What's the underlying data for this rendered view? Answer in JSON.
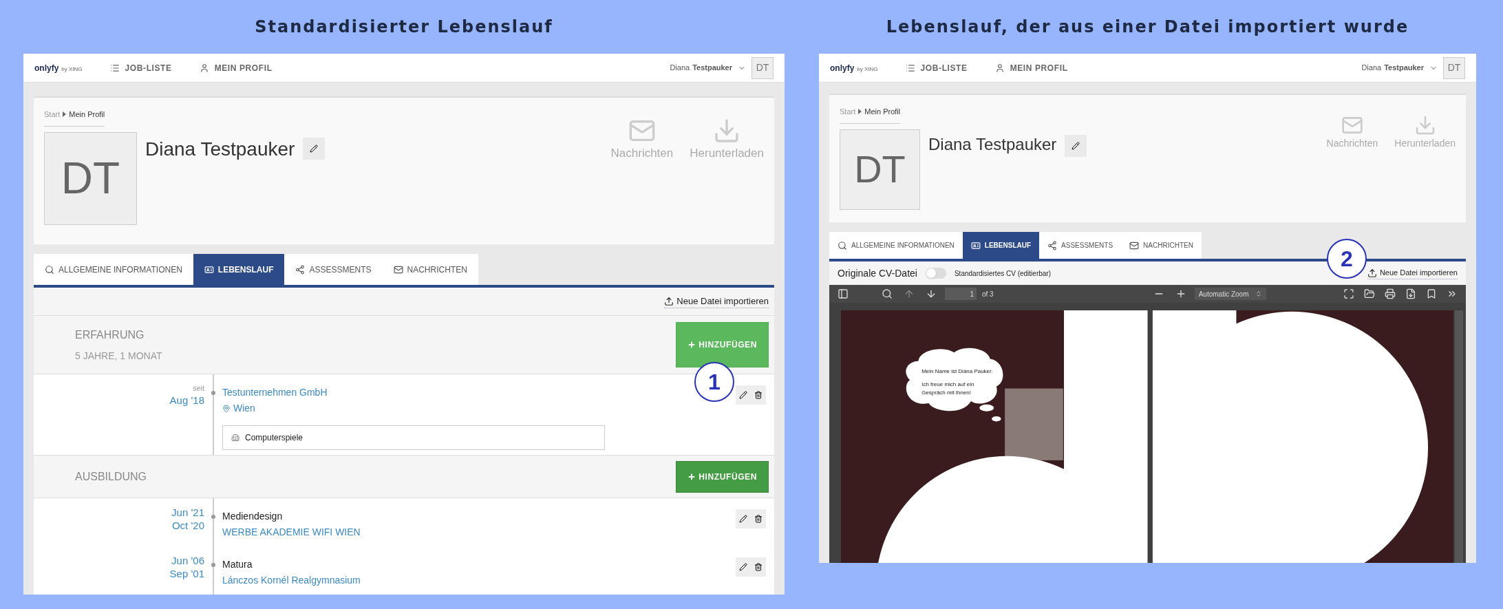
{
  "panels": [
    {
      "kind": "standard",
      "heading": "Standardisierter Lebenslauf",
      "annotation": "1",
      "app": {
        "logo": "onlyfy",
        "logo_sub": "by XING",
        "nav": [
          {
            "label": "JOB-LISTE"
          },
          {
            "label": "MEIN PROFIL"
          }
        ],
        "user_first": "Diana",
        "user_last": "Testpauker",
        "user_initials": "DT",
        "breadcrumb": [
          "Start",
          "Mein Profil"
        ],
        "avatar_initials": "DT",
        "name": "Diana Testpauker",
        "actions": [
          {
            "label": "Nachrichten"
          },
          {
            "label": "Herunterladen"
          }
        ],
        "tabs": [
          {
            "label": "ALLGEMEINE INFORMATIONEN",
            "selected": false
          },
          {
            "label": "LEBENSLAUF",
            "selected": true
          },
          {
            "label": "ASSESSMENTS",
            "selected": false
          },
          {
            "label": "NACHRICHTEN",
            "selected": false
          }
        ]
      },
      "cv": {
        "import_link": "Neue Datei importieren",
        "sections": [
          {
            "title": "ERFAHRUNG",
            "subtitle": "5 JAHRE, 1 MONAT",
            "button": "HINZUFÜGEN",
            "hovered": true,
            "entries": [
              {
                "kind": "job",
                "prefix": "seit",
                "dates": [
                  "Aug '18"
                ],
                "title": "Testunternehmen GmbH",
                "location": "Wien",
                "tags": [
                  "Computerspiele"
                ]
              }
            ]
          },
          {
            "title": "AUSBILDUNG",
            "button": "HINZUFÜGEN",
            "hovered": false,
            "entries": [
              {
                "kind": "education",
                "dates": [
                  "Jun '21",
                  "Oct '20"
                ],
                "title": "Mediendesign",
                "subtitle": "WERBE AKADEMIE WIFI WIEN"
              },
              {
                "kind": "education",
                "dates": [
                  "Jun '06",
                  "Sep '01"
                ],
                "title": "Matura",
                "subtitle": "Lánczos Kornél Realgymnasium"
              }
            ]
          }
        ]
      }
    },
    {
      "kind": "imported",
      "heading": "Lebenslauf, der aus einer Datei importiert wurde",
      "annotation": "2",
      "app": {
        "logo": "onlyfy",
        "logo_sub": "by XING",
        "nav": [
          {
            "label": "JOB-LISTE"
          },
          {
            "label": "MEIN PROFIL"
          }
        ],
        "user_first": "Diana",
        "user_last": "Testpauker",
        "user_initials": "DT",
        "breadcrumb": [
          "Start",
          "Mein Profil"
        ],
        "avatar_initials": "DT",
        "name": "Diana Testpauker",
        "actions": [
          {
            "label": "Nachrichten"
          },
          {
            "label": "Herunterladen"
          }
        ],
        "tabs": [
          {
            "label": "ALLGEMEINE INFORMATIONEN",
            "selected": false
          },
          {
            "label": "LEBENSLAUF",
            "selected": true
          },
          {
            "label": "ASSESSMENTS",
            "selected": false
          },
          {
            "label": "NACHRICHTEN",
            "selected": false
          }
        ]
      },
      "viewer": {
        "toggle": {
          "left_label": "Originale CV-Datei",
          "right_label": "Standardisiertes CV (editierbar)",
          "on": false
        },
        "import_link": "Neue Datei importieren",
        "page": "1",
        "page_count": "of 3",
        "prev_disabled": true,
        "zoom": "Automatic Zoom",
        "bubble": [
          "Mein Name ist Diána Pauker.",
          "Ich freue mich auf ein",
          "Gespräch mit Ihnen!"
        ]
      }
    }
  ]
}
